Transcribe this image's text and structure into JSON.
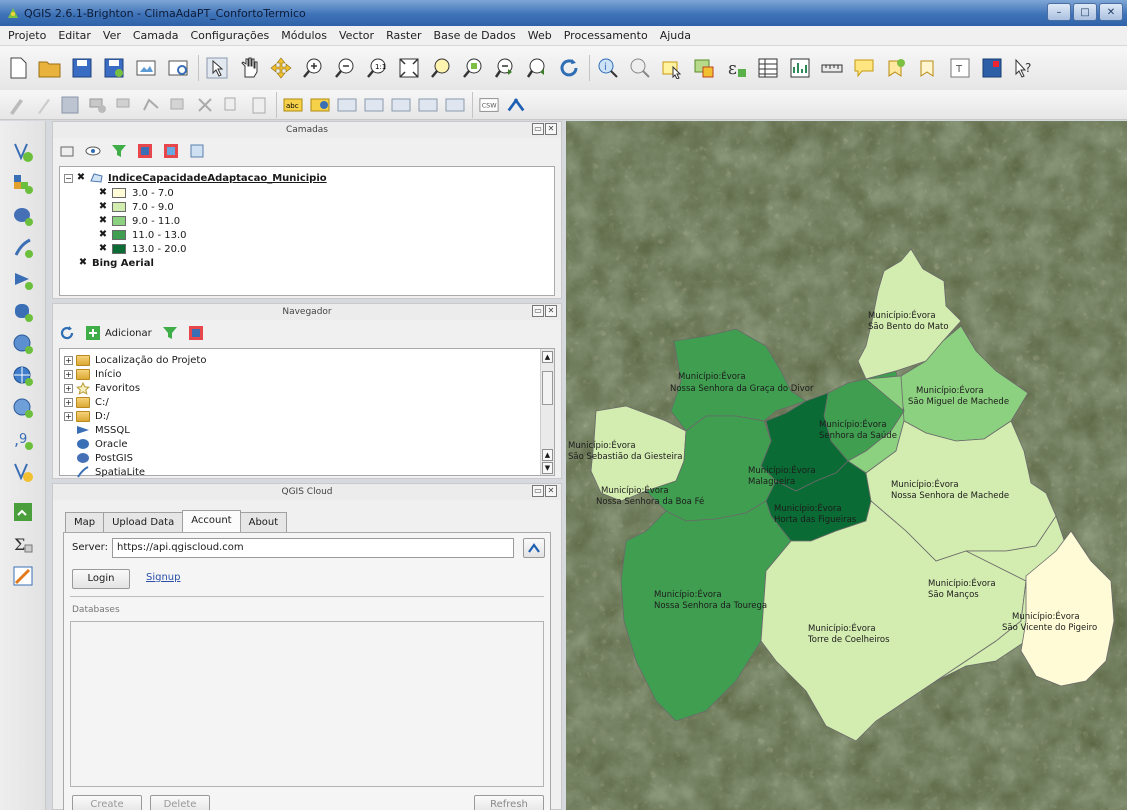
{
  "window": {
    "title": "QGIS 2.6.1-Brighton - ClimaAdaPT_ConfortoTermico",
    "controls": {
      "minimize": "–",
      "maximize": "□",
      "close": "✕"
    }
  },
  "menubar": [
    "Projeto",
    "Editar",
    "Ver",
    "Camada",
    "Configurações",
    "Módulos",
    "Vector",
    "Raster",
    "Base de Dados",
    "Web",
    "Processamento",
    "Ajuda"
  ],
  "colors": {
    "class1": "#fffbd6",
    "class2": "#d3ecb0",
    "class3": "#8cd17f",
    "class4": "#3f9e50",
    "class5": "#0a6b34"
  },
  "layers_panel": {
    "title": "Camadas",
    "layer_name": "IndiceCapacidadeAdaptacao_Municipio",
    "classes": [
      "3.0 - 7.0",
      "7.0 - 9.0",
      "9.0 - 11.0",
      "11.0 - 13.0",
      "13.0 - 20.0"
    ],
    "base_layer": "Bing Aerial"
  },
  "browser_panel": {
    "title": "Navegador",
    "add_label": "Adicionar",
    "items": [
      "Localização do Projeto",
      "Início",
      "Favoritos",
      "C:/",
      "D:/",
      "MSSQL",
      "Oracle",
      "PostGIS",
      "SpatiaLite"
    ]
  },
  "cloud_panel": {
    "title": "QGIS Cloud",
    "tabs": [
      "Map",
      "Upload Data",
      "Account",
      "About"
    ],
    "active_tab": "Account",
    "server_label": "Server:",
    "server_value": "https://api.qgiscloud.com",
    "login_label": "Login",
    "signup_label": "Signup",
    "databases_label": "Databases",
    "create_label": "Create",
    "delete_label": "Delete",
    "refresh_label": "Refresh"
  },
  "map": {
    "regions": [
      {
        "name": "Município:Évora",
        "parish": "São Bento do Mato"
      },
      {
        "name": "Município:Évora",
        "parish": "Nossa Senhora da Graça do Divor"
      },
      {
        "name": "Município:Évora",
        "parish": "São Miguel de Machede"
      },
      {
        "name": "Município:Évora",
        "parish": "Senhora da Saúde"
      },
      {
        "name": "Município:Évora",
        "parish": "São Sebastião da Giesteira"
      },
      {
        "name": "Município:Évora",
        "parish": "Malagueira"
      },
      {
        "name": "Município:Évora",
        "parish": "Nossa Senhora da Boa Fé"
      },
      {
        "name": "Município:Évora",
        "parish": "Horta das Figueiras"
      },
      {
        "name": "Município:Évora",
        "parish": "Nossa Senhora de Machede"
      },
      {
        "name": "Município:Évora",
        "parish": "Nossa Senhora da Tourega"
      },
      {
        "name": "Município:Évora",
        "parish": "São Manços"
      },
      {
        "name": "Município:Évora",
        "parish": "Torre de Coelheiros"
      },
      {
        "name": "Município:Évora",
        "parish": "São Vicente do Pigeiro"
      }
    ]
  }
}
